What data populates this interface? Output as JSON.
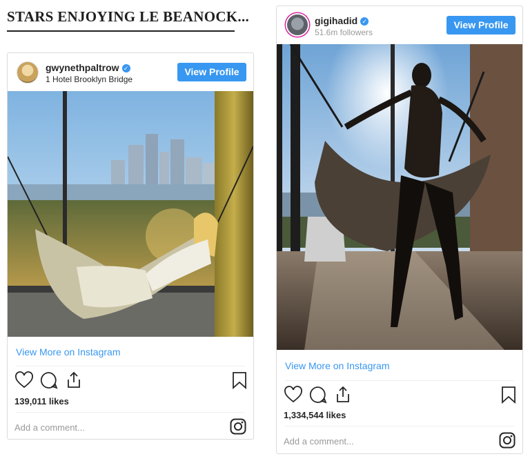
{
  "headline": "STARS ENJOYING LE BEANOCK...",
  "posts": [
    {
      "username": "gwynethpaltrow",
      "subtitle": "1 Hotel Brooklyn Bridge",
      "view_profile": "View Profile",
      "view_more": "View More on Instagram",
      "likes": "139,011 likes",
      "comment_placeholder": "Add a comment..."
    },
    {
      "username": "gigihadid",
      "subtitle": "51.6m followers",
      "view_profile": "View Profile",
      "view_more": "View More on Instagram",
      "likes": "1,334,544 likes",
      "comment_placeholder": "Add a comment..."
    }
  ],
  "icons": [
    "heart-icon",
    "comment-icon",
    "share-icon",
    "bookmark-icon",
    "instagram-icon",
    "verified-badge-icon"
  ],
  "colors": {
    "accent": "#3897f0",
    "text": "#262626",
    "muted": "#999999",
    "border": "#dbdbdb"
  }
}
